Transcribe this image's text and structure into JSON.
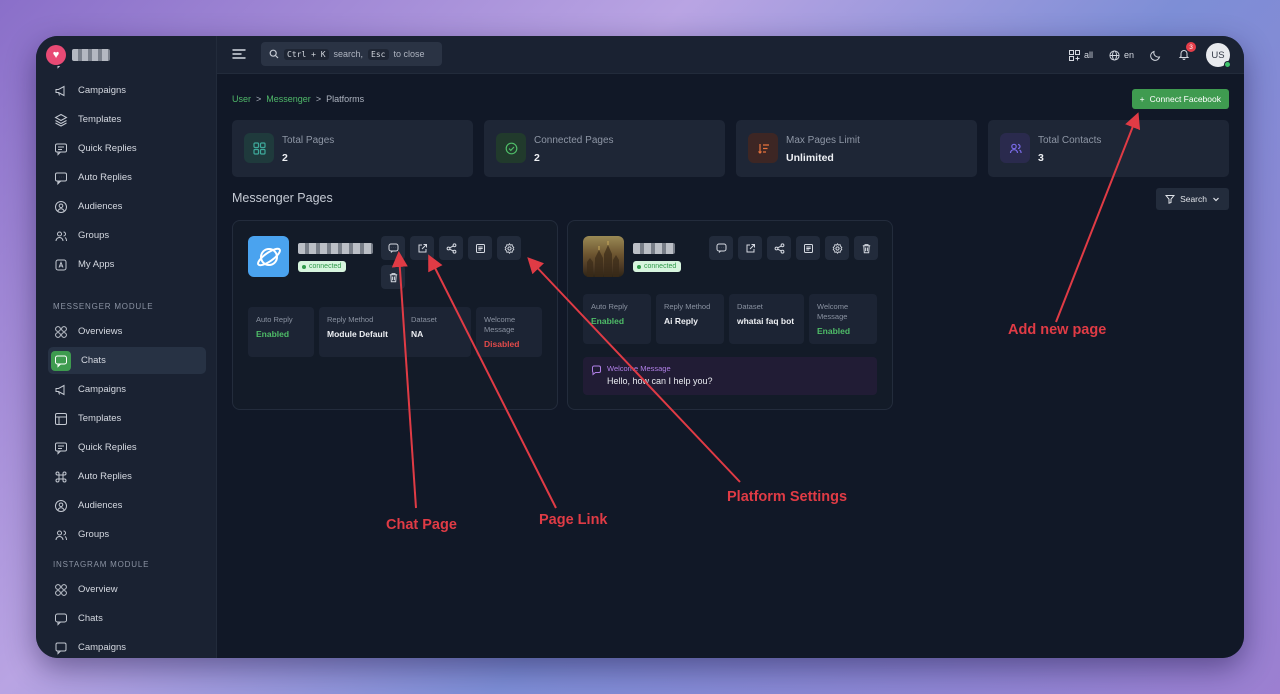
{
  "app": {
    "search_hint_pre": "",
    "kbd_1": "Ctrl + K",
    "search_mid": "search,",
    "kbd_2": "Esc",
    "search_post": "to close",
    "apps_label": "all",
    "lang_label": "en",
    "notif_count": "3",
    "avatar_initials": "US"
  },
  "sidebar": {
    "items_top": [
      {
        "label": "Chats",
        "icon": "chat-icon"
      },
      {
        "label": "Campaigns",
        "icon": "megaphone-icon"
      },
      {
        "label": "Templates",
        "icon": "layers-icon"
      },
      {
        "label": "Quick Replies",
        "icon": "quick-reply-icon"
      },
      {
        "label": "Auto Replies",
        "icon": "auto-reply-icon"
      },
      {
        "label": "Audiences",
        "icon": "audience-icon"
      },
      {
        "label": "Groups",
        "icon": "group-icon"
      },
      {
        "label": "My Apps",
        "icon": "apps-icon"
      }
    ],
    "section_messenger": "MESSENGER MODULE",
    "items_messenger": [
      {
        "label": "Overviews",
        "icon": "grid-icon"
      },
      {
        "label": "Chats",
        "icon": "chat-icon",
        "active": true
      },
      {
        "label": "Campaigns",
        "icon": "megaphone-icon"
      },
      {
        "label": "Templates",
        "icon": "template-icon"
      },
      {
        "label": "Quick Replies",
        "icon": "quick-reply-icon"
      },
      {
        "label": "Auto Replies",
        "icon": "command-icon"
      },
      {
        "label": "Audiences",
        "icon": "audience-icon"
      },
      {
        "label": "Groups",
        "icon": "group-icon"
      }
    ],
    "section_instagram": "INSTAGRAM MODULE",
    "items_instagram": [
      {
        "label": "Overview",
        "icon": "grid-icon"
      },
      {
        "label": "Chats",
        "icon": "chat-icon"
      },
      {
        "label": "Campaigns",
        "icon": "campaign-icon"
      }
    ]
  },
  "breadcrumb": {
    "items": [
      "User",
      "Messenger",
      "Platforms"
    ],
    "sep": ">"
  },
  "connect_button": "Connect Facebook",
  "stats": [
    {
      "label": "Total Pages",
      "value": "2",
      "color": "#3ea99a",
      "bg": "#1f3a3c",
      "icon": "grid-icon"
    },
    {
      "label": "Connected Pages",
      "value": "2",
      "color": "#4fbd68",
      "bg": "#213a2c",
      "icon": "check-circle-icon"
    },
    {
      "label": "Max Pages Limit",
      "value": "Unlimited",
      "color": "#e8733c",
      "bg": "#3d2624",
      "icon": "sort-icon"
    },
    {
      "label": "Total Contacts",
      "value": "3",
      "color": "#7a6be8",
      "bg": "#2a2a4d",
      "icon": "users-icon"
    }
  ],
  "section_title": "Messenger Pages",
  "search_filter": "Search",
  "cards": [
    {
      "status": "connected",
      "info": [
        {
          "label": "Auto Reply",
          "value": "Enabled",
          "tone": "green"
        },
        {
          "label": "Reply Method",
          "value": "Module Default",
          "tone": ""
        },
        {
          "label": "Dataset",
          "value": "NA",
          "tone": ""
        },
        {
          "label": "Welcome Message",
          "value": "Disabled",
          "tone": "red"
        }
      ]
    },
    {
      "status": "connected",
      "info": [
        {
          "label": "Auto Reply",
          "value": "Enabled",
          "tone": "green"
        },
        {
          "label": "Reply Method",
          "value": "Ai Reply",
          "tone": ""
        },
        {
          "label": "Dataset",
          "value": "whatai faq bot",
          "tone": ""
        },
        {
          "label": "Welcome Message",
          "value": "Enabled",
          "tone": "green"
        }
      ],
      "welcome_label": "Welcome Message",
      "welcome_text": "Hello, how can I help you?"
    }
  ],
  "annotations": {
    "chat_page": "Chat Page",
    "page_link": "Page Link",
    "platform_settings": "Platform Settings",
    "add_new_page": "Add new page",
    "color": "#e03b45"
  }
}
